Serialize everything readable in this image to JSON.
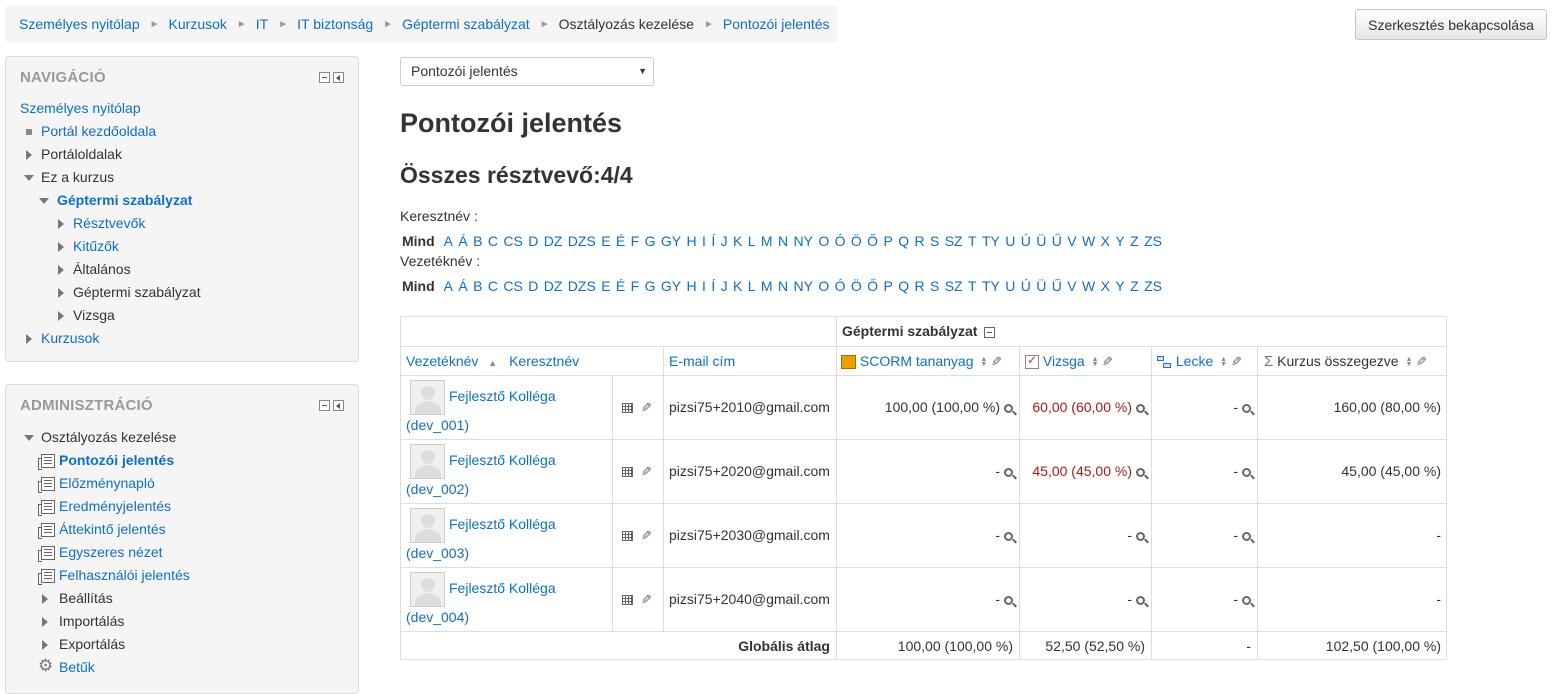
{
  "breadcrumb": [
    "Személyes nyitólap",
    "Kurzusok",
    "IT",
    "IT biztonság",
    "Géptermi szabályzat",
    "Osztályozás kezelése",
    "Pontozói jelentés"
  ],
  "breadcrumb_sep": "►",
  "edit_button": "Szerkesztés bekapcsolása",
  "nav": {
    "title": "NAVIGÁCIÓ",
    "home": "Személyes nyitólap",
    "site_home": "Portál kezdőoldala",
    "site_pages": "Portáloldalak",
    "this_course": "Ez a kurzus",
    "course": "Géptermi szabályzat",
    "participants": "Résztvevők",
    "badges": "Kitűzők",
    "general": "Általános",
    "section": "Géptermi szabályzat",
    "exam": "Vizsga",
    "courses": "Kurzusok"
  },
  "admin": {
    "title": "ADMINISZTRÁCIÓ",
    "grades": "Osztályozás kezelése",
    "items": [
      "Pontozói jelentés",
      "Előzménynapló",
      "Eredményjelentés",
      "Áttekintő jelentés",
      "Egyszeres nézet",
      "Felhasználói jelentés"
    ],
    "setup": "Beállítás",
    "import": "Importálás",
    "export": "Exportálás",
    "letters": "Betűk"
  },
  "report_select": "Pontozói jelentés",
  "page_title": "Pontozói jelentés",
  "participants_total": "Összes résztvevő:4/4",
  "firstname_label": "Keresztnév :",
  "lastname_label": "Vezetéknév :",
  "initials_all": "Mind",
  "letters": [
    "A",
    "Á",
    "B",
    "C",
    "CS",
    "D",
    "DZ",
    "DZS",
    "E",
    "É",
    "F",
    "G",
    "GY",
    "H",
    "I",
    "Í",
    "J",
    "K",
    "L",
    "M",
    "N",
    "NY",
    "O",
    "Ó",
    "Ö",
    "Ő",
    "P",
    "Q",
    "R",
    "S",
    "SZ",
    "T",
    "TY",
    "U",
    "Ú",
    "Ü",
    "Ű",
    "V",
    "W",
    "X",
    "Y",
    "Z",
    "ZS"
  ],
  "table": {
    "category": "Géptermi szabályzat",
    "col_lastname": "Vezetéknév",
    "col_firstname": "Keresztnév",
    "col_email": "E-mail cím",
    "col_scorm": "SCORM tananyag",
    "col_exam": "Vizsga",
    "col_lesson": "Lecke",
    "col_total": "Kurzus összegezve",
    "rows": [
      {
        "name": "Fejlesztő Kolléga",
        "username": "(dev_001)",
        "email": "pizsi75+2010@gmail.com",
        "scorm": "100,00 (100,00 %)",
        "exam": "60,00 (60,00 %)",
        "lesson": "-",
        "total": "160,00 (80,00 %)"
      },
      {
        "name": "Fejlesztő Kolléga",
        "username": "(dev_002)",
        "email": "pizsi75+2020@gmail.com",
        "scorm": "-",
        "exam": "45,00 (45,00 %)",
        "lesson": "-",
        "total": "45,00 (45,00 %)"
      },
      {
        "name": "Fejlesztő Kolléga",
        "username": "(dev_003)",
        "email": "pizsi75+2030@gmail.com",
        "scorm": "-",
        "exam": "-",
        "lesson": "-",
        "total": "-"
      },
      {
        "name": "Fejlesztő Kolléga",
        "username": "(dev_004)",
        "email": "pizsi75+2040@gmail.com",
        "scorm": "-",
        "exam": "-",
        "lesson": "-",
        "total": "-"
      }
    ],
    "avg_label": "Globális átlag",
    "avg": {
      "scorm": "100,00 (100,00 %)",
      "exam": "52,50 (52,50 %)",
      "lesson": "-",
      "total": "102,50 (100,00 %)"
    }
  },
  "colors": {
    "link": "#0f6fc5",
    "failed_grade": "#a61a1a",
    "block_bg": "#f5f5f5"
  }
}
